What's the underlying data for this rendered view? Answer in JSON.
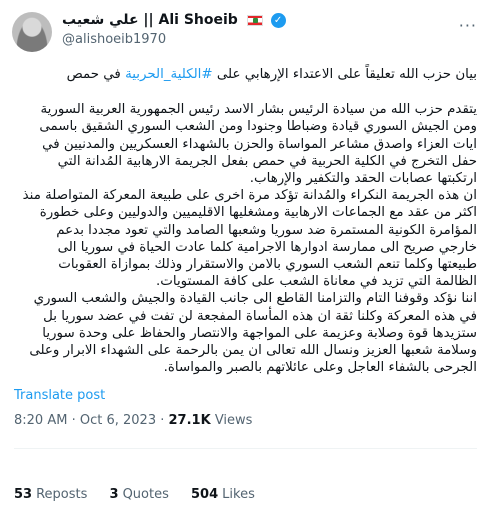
{
  "author": {
    "name_ar": "علي شعيب",
    "separator": "||",
    "name_en": "Ali Shoeib",
    "handle": "@alishoeib1970"
  },
  "tweet": {
    "headline_before": "بيان حزب الله تعليقاً على الاعتداء الإرهابي على ",
    "headline_hashtag": "#الكلية_الحربية",
    "headline_after": " في حمص",
    "paragraphs": [
      "يتقدم حزب الله من سيادة الرئيس بشار الاسد رئيس الجمهورية العربية السورية ومن الجيش السوري قيادة وضباطا وجنودا ومن الشعب السوري الشقيق باسمى ايات العزاء واصدق مشاعر المواساة والحزن بالشهداء العسكريين والمدنيين في حفل التخرج في الكلية الحربية في حمص بفعل الجريمة الارهابية المُدانة التي ارتكبتها عصابات الحقد والتكفير والإرهاب.",
      "ان هذه الجريمة النكراء والمُدانة تؤكد مرة اخرى على طبيعة المعركة المتواصلة منذ اكثر من عقد مع الجماعات الارهابية ومشغليها الاقليميين والدوليين وعلى خطورة المؤامرة الكونية المستمرة ضد سوريا وشعبها الصامد والتي تعود مجددا بدعم خارجي صريح الى ممارسة ادوارها الاجرامية كلما عادت الحياة في سوريا الى طبيعتها وكلما تنعم الشعب السوري بالامن والاستقرار وذلك بموازاة العقوبات الظالمة التي تزيد في معاناة الشعب على كافة المستويات.",
      "اننا نؤكد وقوفنا التام والتزامنا القاطع الى جانب القيادة والجيش والشعب السوري في هذه المعركة  وكلنا ثقة ان هذه المأساة المفجعة لن تفت في عضد سوريا بل ستزيدها قوة وصلابة وعزيمة على المواجهة والانتصار والحفاظ على وحدة سوريا وسلامة شعبها العزيز  ونسال الله تعالى ان يمن بالرحمة على الشهداء الابرار وعلى الجرحى بالشفاء العاجل وعلى عائلاتهم بالصبر والمواساة."
    ]
  },
  "translate_label": "Translate post",
  "meta": {
    "time": "8:20 AM",
    "dot": "·",
    "date": "Oct 6, 2023",
    "views_count": "27.1K",
    "views_label": "Views"
  },
  "stats": {
    "reposts_count": "53",
    "reposts_label": "Reposts",
    "quotes_count": "3",
    "quotes_label": "Quotes",
    "likes_count": "504",
    "likes_label": "Likes"
  },
  "icons": [
    "verified-badge-icon",
    "lebanon-flag-icon",
    "more-icon"
  ],
  "colors": {
    "link": "#1d9bf0",
    "secondary_text": "#536471",
    "verified": "#1d9bf0"
  }
}
